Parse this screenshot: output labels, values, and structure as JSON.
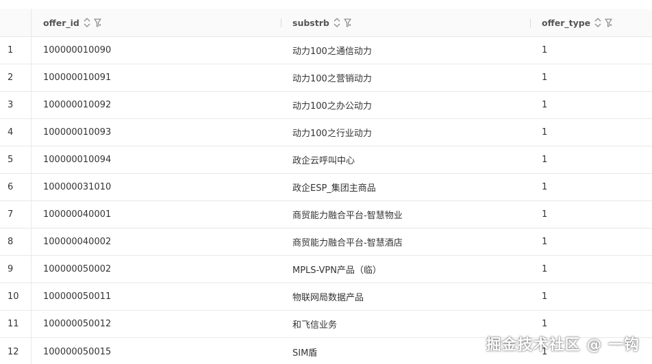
{
  "columns": [
    {
      "key": "offer_id",
      "label": "offer_id"
    },
    {
      "key": "substrb",
      "label": "substrb"
    },
    {
      "key": "offer_type",
      "label": "offer_type"
    }
  ],
  "rows": [
    {
      "idx": "1",
      "offer_id": "100000010090",
      "substrb": "动力100之通信动力",
      "offer_type": "1"
    },
    {
      "idx": "2",
      "offer_id": "100000010091",
      "substrb": "动力100之营销动力",
      "offer_type": "1"
    },
    {
      "idx": "3",
      "offer_id": "100000010092",
      "substrb": "动力100之办公动力",
      "offer_type": "1"
    },
    {
      "idx": "4",
      "offer_id": "100000010093",
      "substrb": "动力100之行业动力",
      "offer_type": "1"
    },
    {
      "idx": "5",
      "offer_id": "100000010094",
      "substrb": "政企云呼叫中心",
      "offer_type": "1"
    },
    {
      "idx": "6",
      "offer_id": "100000031010",
      "substrb": "政企ESP_集团主商品",
      "offer_type": "1"
    },
    {
      "idx": "7",
      "offer_id": "100000040001",
      "substrb": "商贸能力融合平台-智慧物业",
      "offer_type": "1"
    },
    {
      "idx": "8",
      "offer_id": "100000040002",
      "substrb": "商贸能力融合平台-智慧酒店",
      "offer_type": "1"
    },
    {
      "idx": "9",
      "offer_id": "100000050002",
      "substrb": "MPLS-VPN产品（临）",
      "offer_type": "1"
    },
    {
      "idx": "10",
      "offer_id": "100000050011",
      "substrb": "物联网局数据产品",
      "offer_type": "1"
    },
    {
      "idx": "11",
      "offer_id": "100000050012",
      "substrb": "和飞信业务",
      "offer_type": "1"
    },
    {
      "idx": "12",
      "offer_id": "100000050015",
      "substrb": "SIM盾",
      "offer_type": "1"
    }
  ],
  "watermark": "掘金技术社区 @ 一钩",
  "icons": {
    "sort": "sort-icon",
    "filter": "filter-icon"
  },
  "colors": {
    "border": "#e8e8e8",
    "header_bg": "#fafafa",
    "text": "#333333"
  }
}
